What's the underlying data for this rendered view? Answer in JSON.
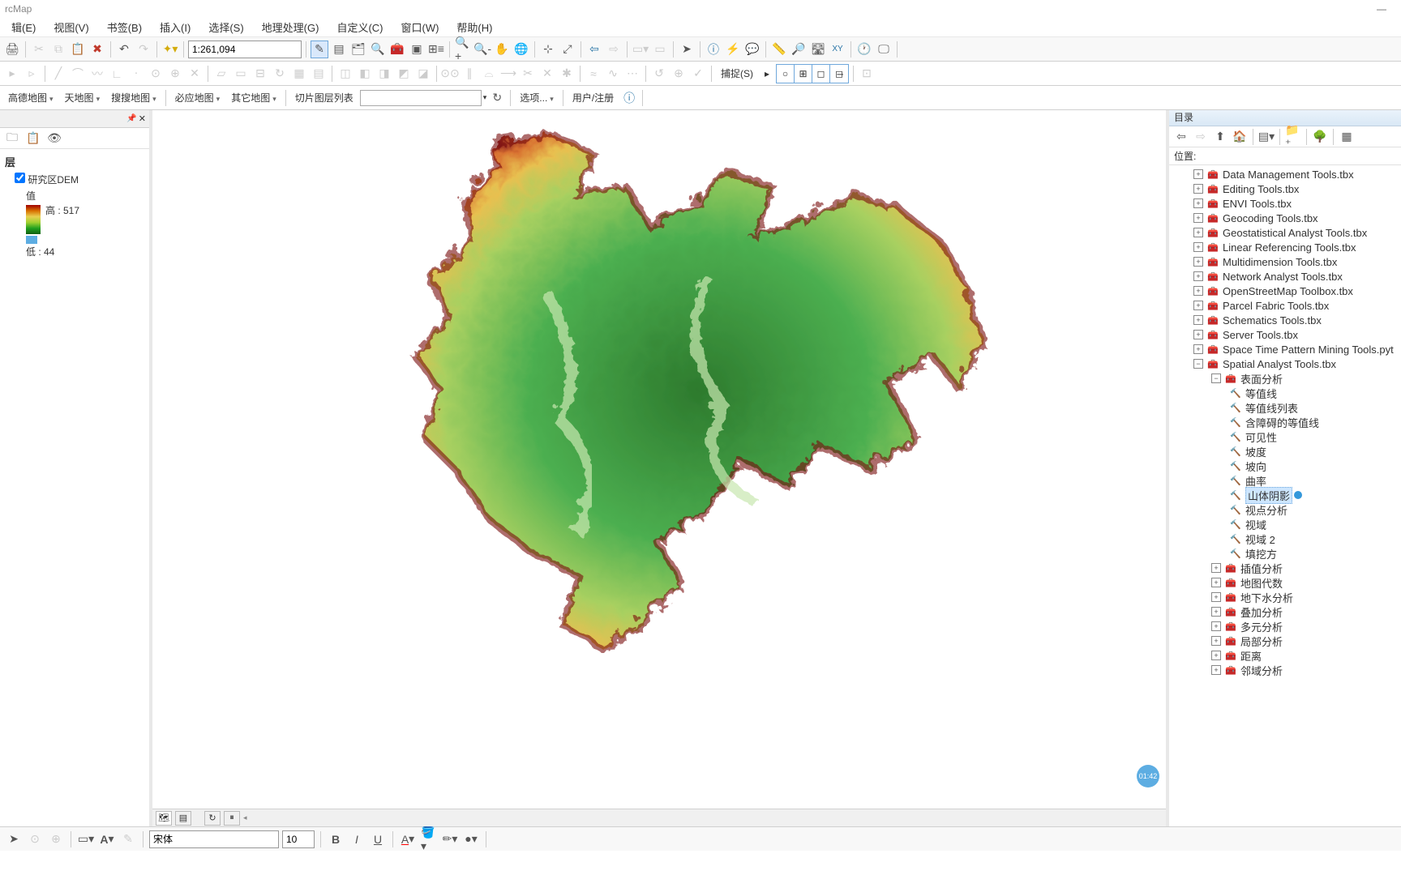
{
  "app": {
    "title": "rcMap"
  },
  "menu": [
    "辑(E)",
    "视图(V)",
    "书签(B)",
    "插入(I)",
    "选择(S)",
    "地理处理(G)",
    "自定义(C)",
    "窗口(W)",
    "帮助(H)"
  ],
  "scale": "1:261,094",
  "basemap_tb": {
    "items": [
      "高德地图",
      "天地图",
      "搜搜地图",
      "必应地图",
      "其它地图"
    ],
    "slice_label": "切片图层列表",
    "options": "选项...",
    "user": "用户/注册"
  },
  "snap_label": "捕捉(S)",
  "toc": {
    "group": "层",
    "layer": "研究区DEM",
    "value_label": "值",
    "high": "高 : 517",
    "low": "低 : 44"
  },
  "catalog": {
    "title": "目录",
    "location_label": "位置:",
    "toolboxes": [
      "Data Management Tools.tbx",
      "Editing Tools.tbx",
      "ENVI Tools.tbx",
      "Geocoding Tools.tbx",
      "Geostatistical Analyst Tools.tbx",
      "Linear Referencing Tools.tbx",
      "Multidimension Tools.tbx",
      "Network Analyst Tools.tbx",
      "OpenStreetMap Toolbox.tbx",
      "Parcel Fabric Tools.tbx",
      "Schematics Tools.tbx",
      "Server Tools.tbx"
    ],
    "spacetime_tool": "Space Time Pattern Mining Tools.pyt",
    "spatial_analyst": "Spatial Analyst Tools.tbx",
    "surface_toolset": "表面分析",
    "surface_tools": [
      "等值线",
      "等值线列表",
      "含障碍的等值线",
      "可见性",
      "坡度",
      "坡向",
      "曲率",
      "山体阴影",
      "视点分析",
      "视域",
      "视域 2",
      "填挖方"
    ],
    "other_toolsets": [
      "插值分析",
      "地图代数",
      "地下水分析",
      "叠加分析",
      "多元分析",
      "局部分析",
      "距离",
      "邻域分析"
    ]
  },
  "badge_time": "01:42",
  "font": {
    "name": "宋体",
    "size": "10"
  }
}
